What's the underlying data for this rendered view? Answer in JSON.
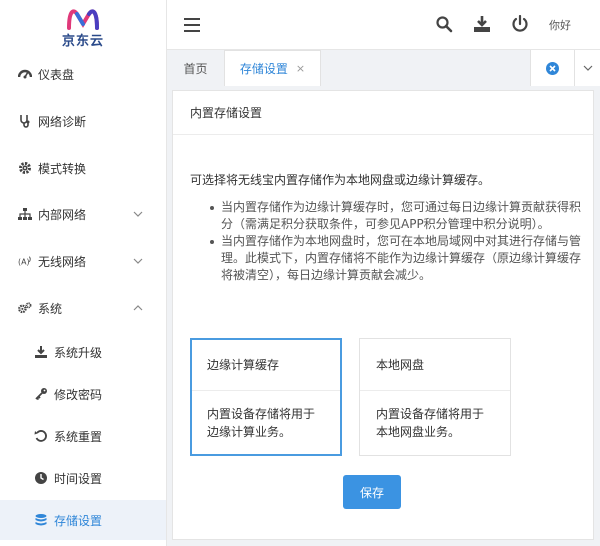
{
  "brand": {
    "logo_text": "京东云"
  },
  "header": {
    "greeting": "你好",
    "icons": [
      "menu-icon",
      "search-icon",
      "download-icon",
      "power-icon"
    ]
  },
  "sidebar": {
    "items": [
      {
        "label": "仪表盘",
        "icon": "dashboard-icon"
      },
      {
        "label": "网络诊断",
        "icon": "stethoscope-icon"
      },
      {
        "label": "模式转换",
        "icon": "gear-icon"
      },
      {
        "label": "内部网络",
        "icon": "sitemap-icon"
      },
      {
        "label": "无线网络",
        "icon": "wifi-antenna-icon"
      },
      {
        "label": "系统",
        "icon": "cogs-icon"
      }
    ],
    "sub_items": [
      {
        "label": "系统升级",
        "icon": "download-icon"
      },
      {
        "label": "修改密码",
        "icon": "key-icon"
      },
      {
        "label": "系统重置",
        "icon": "undo-icon"
      },
      {
        "label": "时间设置",
        "icon": "clock-icon"
      },
      {
        "label": "存储设置",
        "icon": "database-icon",
        "active": true
      }
    ]
  },
  "tabs": [
    {
      "label": "首页"
    },
    {
      "label": "存储设置",
      "active": true,
      "close": "×"
    }
  ],
  "main": {
    "title": "内置存储设置",
    "intro": "可选择将无线宝内置存储作为本地网盘或边缘计算缓存。",
    "bullets": [
      "当内置存储作为边缘计算缓存时，您可通过每日边缘计算贡献获得积分（需满足积分获取条件，可参见APP积分管理中积分说明）。",
      "当内置存储作为本地网盘时，您可在本地局域网中对其进行存储与管理。此模式下，内置存储将不能作为边缘计算缓存（原边缘计算缓存将被清空），每日边缘计算贡献会减少。"
    ],
    "options": [
      {
        "title": "边缘计算缓存",
        "desc": "内置设备存储将用于边缘计算业务。",
        "selected": true
      },
      {
        "title": "本地网盘",
        "desc": "内置设备存储将用于本地网盘业务。",
        "selected": false
      }
    ],
    "save_label": "保存"
  },
  "colors": {
    "accent": "#2f86d8",
    "button": "#3b93e2",
    "selected_border": "#4a9be0"
  }
}
